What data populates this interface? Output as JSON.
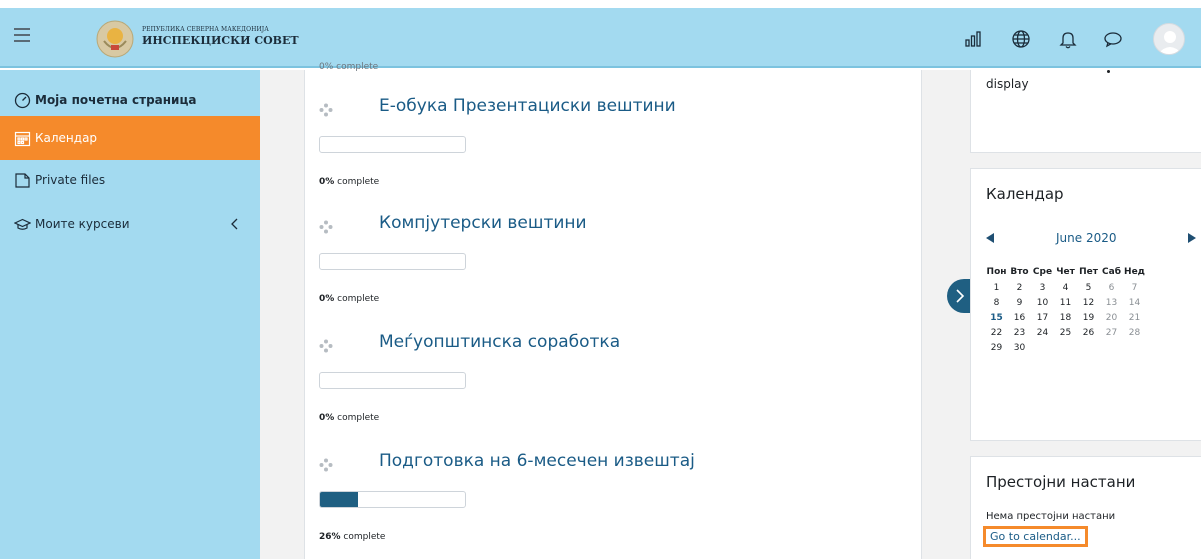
{
  "header": {
    "logo_line1": "РЕПУБЛИКА СЕВЕРНА МАКЕДОНИЈА",
    "logo_line2": "ИНСПЕКЦИСКИ СОВЕТ",
    "icons": [
      "hamburger-icon",
      "bar-chart-icon",
      "globe-icon",
      "bell-icon",
      "chat-icon",
      "avatar"
    ]
  },
  "sidebar": {
    "items": [
      {
        "label": "Моја почетна страница",
        "icon": "dashboard-icon"
      },
      {
        "label": "Календар",
        "icon": "calendar-icon",
        "active": true
      },
      {
        "label": "Private files",
        "icon": "file-icon"
      },
      {
        "label": "Моите курсеви",
        "icon": "graduation-cap-icon",
        "expandable": true
      }
    ]
  },
  "main": {
    "cut_label": "0% complete",
    "courses": [
      {
        "title": "Е-обука Презентациски вештини",
        "percent": 0,
        "percent_text": "0%",
        "suffix": " complete"
      },
      {
        "title": "Компјутерски вештини",
        "percent": 0,
        "percent_text": "0%",
        "suffix": " complete"
      },
      {
        "title": "Меѓуопштинска соработка",
        "percent": 0,
        "percent_text": "0%",
        "suffix": " complete"
      },
      {
        "title": "Подготовка на 6-месечен извештај",
        "percent": 26,
        "percent_text": "26%",
        "suffix": " complete"
      }
    ]
  },
  "right": {
    "block1_text": "display",
    "calendar": {
      "title": "Календар",
      "month": "June 2020",
      "weekdays": [
        "Пон",
        "Вто",
        "Сре",
        "Чет",
        "Пет",
        "Саб",
        "Нед"
      ],
      "weeks": [
        [
          "1",
          "2",
          "3",
          "4",
          "5",
          "6",
          "7"
        ],
        [
          "8",
          "9",
          "10",
          "11",
          "12",
          "13",
          "14"
        ],
        [
          "15",
          "16",
          "17",
          "18",
          "19",
          "20",
          "21"
        ],
        [
          "22",
          "23",
          "24",
          "25",
          "26",
          "27",
          "28"
        ],
        [
          "29",
          "30",
          "",
          "",
          "",
          "",
          ""
        ]
      ],
      "today": "15"
    },
    "upcoming": {
      "title": "Престојни настани",
      "empty_text": "Нема престојни настани",
      "link": "Go to calendar..."
    }
  },
  "colors": {
    "header_bg": "#a3daf0",
    "active_item": "#f58a2b",
    "link": "#1a5b86",
    "progress_fill": "#1f5f82"
  }
}
